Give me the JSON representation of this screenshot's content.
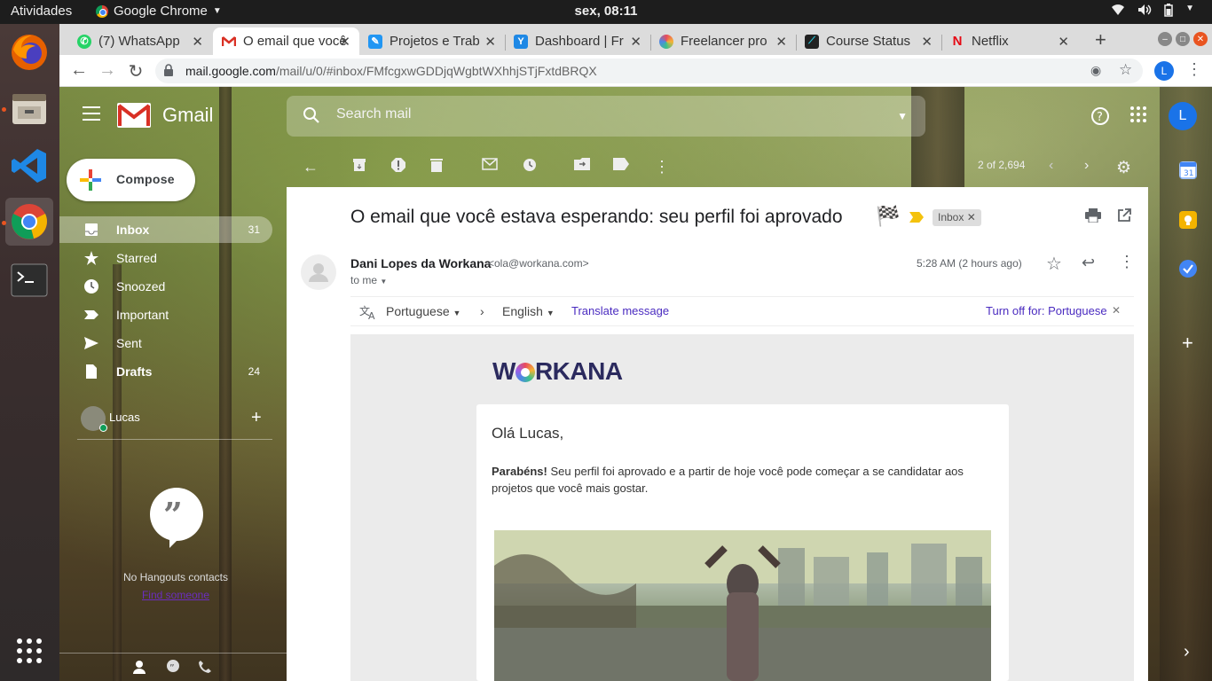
{
  "os": {
    "activities": "Atividades",
    "app_name": "Google Chrome",
    "clock": "sex, 08:11"
  },
  "browser": {
    "tabs": [
      {
        "title": "(7) WhatsApp",
        "icon": "whatsapp-icon",
        "color": "#25d366"
      },
      {
        "title": "O email que você",
        "icon": "gmail-icon",
        "color": "#d93025"
      },
      {
        "title": "Projetos e Trab",
        "icon": "workana-icon",
        "color": "#2196f3"
      },
      {
        "title": "Dashboard | Fr",
        "icon": "freelancer-dashboard-icon",
        "color": "#1e88e5"
      },
      {
        "title": "Freelancer pro",
        "icon": "freelancer-icon",
        "color": "#7e57c2"
      },
      {
        "title": "Course Status",
        "icon": "course-icon",
        "color": "#26a69a"
      },
      {
        "title": "Netflix",
        "icon": "netflix-icon",
        "color": "#e50914"
      }
    ],
    "url_host": "mail.google.com",
    "url_path": "/mail/u/0/#inbox/FMfcgxwGDDjqWgbtWXhhjSTjFxtdBRQX",
    "profile_initial": "L"
  },
  "gmail": {
    "brand": "Gmail",
    "search_placeholder": "Search mail",
    "compose_label": "Compose",
    "nav": [
      {
        "label": "Inbox",
        "count": "31",
        "icon": "inbox-icon"
      },
      {
        "label": "Starred",
        "count": "",
        "icon": "star-icon"
      },
      {
        "label": "Snoozed",
        "count": "",
        "icon": "clock-icon"
      },
      {
        "label": "Important",
        "count": "",
        "icon": "important-icon"
      },
      {
        "label": "Sent",
        "count": "",
        "icon": "send-icon"
      },
      {
        "label": "Drafts",
        "count": "24",
        "icon": "draft-icon"
      }
    ],
    "hangouts_user": "Lucas",
    "no_contacts": "No Hangouts contacts",
    "find_someone": "Find someone",
    "pager": "2 of 2,694",
    "account_initial": "L"
  },
  "message": {
    "subject": "O email que você estava esperando: seu perfil foi aprovado",
    "label_chip": "Inbox",
    "sender_name": "Dani Lopes da Workana",
    "sender_email": "<ola@workana.com>",
    "to": "to me",
    "time": "5:28 AM (2 hours ago)",
    "translate": {
      "from_lang": "Portuguese",
      "to_lang": "English",
      "action": "Translate message",
      "turn_off": "Turn off for: Portuguese"
    },
    "body": {
      "brand_pre": "W",
      "brand_post": "RKANA",
      "greeting": "Olá Lucas,",
      "bold_lead": "Parabéns!",
      "paragraph": "Seu perfil foi aprovado e a partir de hoje você pode começar a se candidatar aos projetos que você mais gostar."
    }
  }
}
